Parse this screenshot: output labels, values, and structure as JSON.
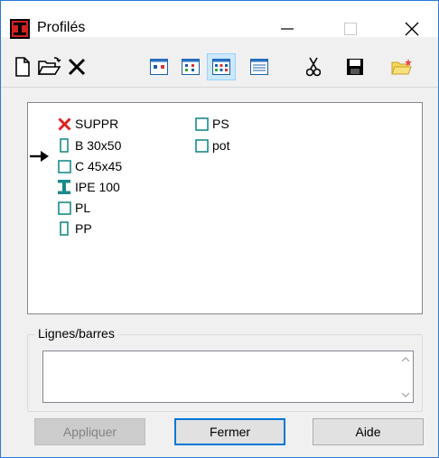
{
  "window": {
    "title": "Profilés",
    "icon": "i-beam-red-icon",
    "controls": [
      "minimize-icon",
      "maximize-icon",
      "close-icon"
    ]
  },
  "toolbar": {
    "buttons": [
      {
        "name": "new-icon"
      },
      {
        "name": "open-folder-icon"
      },
      {
        "name": "delete-icon"
      },
      {
        "name": "view-large-icons-icon"
      },
      {
        "name": "view-small-icons-icon"
      },
      {
        "name": "view-list-icon",
        "pressed": true
      },
      {
        "name": "view-details-icon"
      },
      {
        "name": "cut-icon"
      },
      {
        "name": "save-icon"
      },
      {
        "name": "open-star-folder-icon"
      }
    ]
  },
  "profiles": {
    "current": "B 30x50",
    "items": [
      {
        "label": "SUPPR",
        "icon": "delete-x-icon"
      },
      {
        "label": "B 30x50",
        "icon": "rectangle-tall-icon"
      },
      {
        "label": "C 45x45",
        "icon": "square-icon"
      },
      {
        "label": "IPE 100",
        "icon": "i-beam-icon"
      },
      {
        "label": "PL",
        "icon": "square-icon"
      },
      {
        "label": "PP",
        "icon": "rectangle-tall-icon"
      },
      {
        "label": "PS",
        "icon": "square-icon"
      },
      {
        "label": "pot",
        "icon": "square-icon"
      }
    ]
  },
  "lines": {
    "group_label": "Lignes/barres",
    "value": ""
  },
  "buttons": {
    "apply": "Appliquer",
    "close": "Fermer",
    "help": "Aide"
  },
  "colors": {
    "icon_teal": "#1a8a8a",
    "delete_red": "#e02020",
    "accent": "#0078d7"
  }
}
